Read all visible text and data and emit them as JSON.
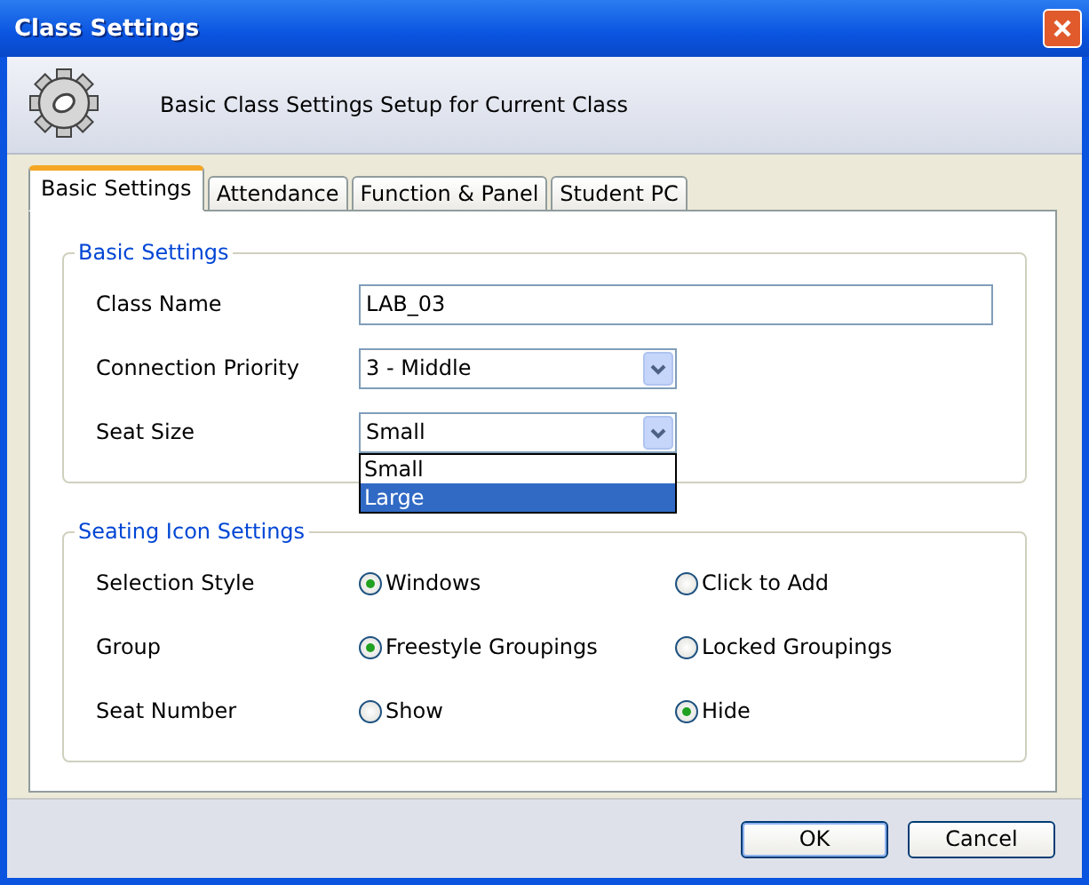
{
  "window": {
    "title": "Class Settings"
  },
  "header": {
    "text": "Basic Class Settings Setup for Current Class"
  },
  "tabs": [
    {
      "label": "Basic Settings",
      "selected": true
    },
    {
      "label": "Attendance",
      "selected": false
    },
    {
      "label": "Function & Panel",
      "selected": false
    },
    {
      "label": "Student PC",
      "selected": false
    }
  ],
  "basic_settings": {
    "title": "Basic Settings",
    "fields": [
      {
        "kind": "text",
        "label": "Class Name",
        "value": "LAB_03"
      },
      {
        "kind": "select",
        "label": "Connection Priority",
        "value": "3 - Middle"
      },
      {
        "kind": "select",
        "label": "Seat Size",
        "value": "Small",
        "options": [
          {
            "label": "Small",
            "highlighted": false
          },
          {
            "label": "Large",
            "highlighted": true
          }
        ]
      }
    ]
  },
  "seating_icon_settings": {
    "title": "Seating Icon Settings",
    "rows": [
      {
        "label": "Selection Style",
        "options": [
          {
            "label": "Windows",
            "selected": true
          },
          {
            "label": "Click to Add",
            "selected": false
          }
        ]
      },
      {
        "label": "Group",
        "options": [
          {
            "label": "Freestyle Groupings",
            "selected": true
          },
          {
            "label": "Locked Groupings",
            "selected": false
          }
        ]
      },
      {
        "label": "Seat Number",
        "options": [
          {
            "label": "Show",
            "selected": false
          },
          {
            "label": "Hide",
            "selected": true
          }
        ]
      }
    ]
  },
  "buttons": [
    {
      "label": "OK",
      "default": true
    },
    {
      "label": "Cancel",
      "default": false
    }
  ]
}
